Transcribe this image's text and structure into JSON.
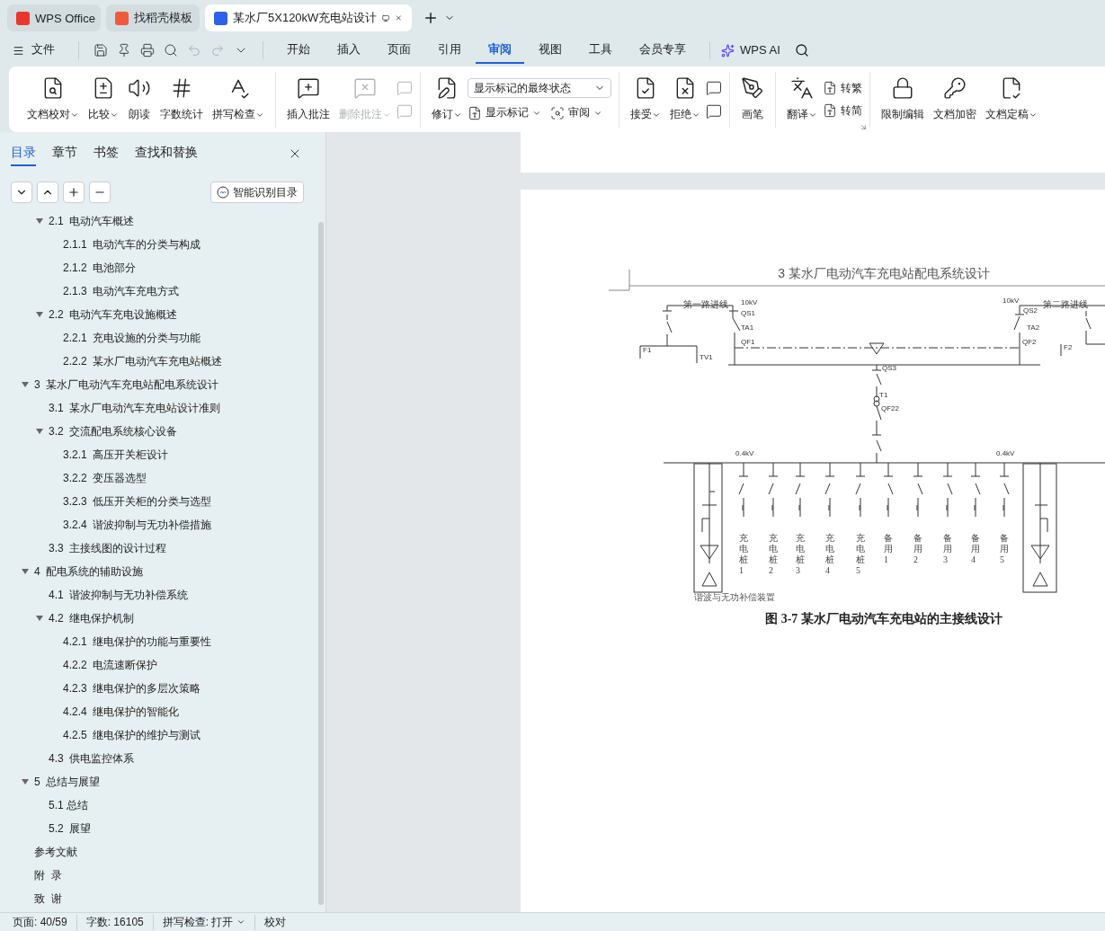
{
  "app_tabs": [
    {
      "label": "WPS Office",
      "selected": false
    },
    {
      "label": "找稻壳模板",
      "selected": false
    },
    {
      "label": "某水厂5X120kW充电站设计",
      "selected": true
    }
  ],
  "menu": {
    "file": "文件",
    "quick_access": [
      {
        "disabled": false
      },
      {
        "disabled": false
      },
      {
        "disabled": false
      },
      {
        "disabled": false
      },
      {
        "disabled": true
      },
      {
        "disabled": true
      },
      {
        "disabled": false
      }
    ],
    "tabs": [
      {
        "label": "开始",
        "selected": false
      },
      {
        "label": "插入",
        "selected": false
      },
      {
        "label": "页面",
        "selected": false
      },
      {
        "label": "引用",
        "selected": false
      },
      {
        "label": "审阅",
        "selected": true
      },
      {
        "label": "视图",
        "selected": false
      },
      {
        "label": "工具",
        "selected": false
      },
      {
        "label": "会员专享",
        "selected": false
      }
    ],
    "ai": "WPS AI"
  },
  "ribbon": [
    {
      "items": [
        {
          "kind": "large",
          "label": "文档校对",
          "dropdown": true,
          "disabled": false
        },
        {
          "kind": "large",
          "label": "比较",
          "dropdown": true,
          "disabled": false
        },
        {
          "kind": "large",
          "label": "朗读",
          "dropdown": false,
          "disabled": false
        },
        {
          "kind": "large",
          "label": "字数统计",
          "dropdown": false,
          "disabled": false
        },
        {
          "kind": "large",
          "label": "拼写检查",
          "dropdown": true,
          "disabled": false
        }
      ]
    },
    {
      "items": [
        {
          "kind": "large",
          "label": "插入批注",
          "dropdown": false,
          "disabled": false
        },
        {
          "kind": "large",
          "label": "删除批注",
          "dropdown": true,
          "disabled": true
        },
        {
          "kind": "stack",
          "items": [
            {
              "kind": "icon",
              "disabled": true
            },
            {
              "kind": "icon",
              "disabled": true
            }
          ]
        }
      ]
    },
    {
      "items": [
        {
          "kind": "large",
          "label": "修订",
          "dropdown": true,
          "disabled": false
        },
        {
          "kind": "stack",
          "items": [
            {
              "kind": "select",
              "value": "显示标记的最终状态"
            },
            {
              "kind": "row",
              "items": [
                {
                  "kind": "small",
                  "label": "显示标记",
                  "dropdown": true
                },
                {
                  "kind": "small",
                  "label": "审阅",
                  "dropdown": true
                }
              ]
            }
          ]
        }
      ]
    },
    {
      "items": [
        {
          "kind": "large",
          "label": "接受",
          "dropdown": true,
          "disabled": false
        },
        {
          "kind": "large",
          "label": "拒绝",
          "dropdown": true,
          "disabled": false
        },
        {
          "kind": "stack",
          "items": [
            {
              "kind": "icon",
              "disabled": false
            },
            {
              "kind": "icon",
              "disabled": false
            }
          ]
        }
      ]
    },
    {
      "items": [
        {
          "kind": "large",
          "label": "画笔",
          "dropdown": false,
          "disabled": false
        }
      ]
    },
    {
      "items": [
        {
          "kind": "large",
          "label": "翻译",
          "dropdown": true,
          "disabled": false
        },
        {
          "kind": "stack",
          "items": [
            {
              "kind": "small",
              "label": "转繁",
              "dropdown": false
            },
            {
              "kind": "small",
              "label": "转简",
              "dropdown": false
            }
          ]
        }
      ],
      "launcher": true
    },
    {
      "items": [
        {
          "kind": "large",
          "label": "限制编辑",
          "dropdown": false,
          "disabled": false
        },
        {
          "kind": "large",
          "label": "文档加密",
          "dropdown": false,
          "disabled": false
        },
        {
          "kind": "large",
          "label": "文档定稿",
          "dropdown": true,
          "disabled": false
        }
      ]
    }
  ],
  "nav_pane": {
    "tabs": [
      {
        "label": "目录",
        "selected": true
      },
      {
        "label": "章节",
        "selected": false
      },
      {
        "label": "书签",
        "selected": false
      },
      {
        "label": "查找和替换",
        "selected": false
      }
    ],
    "smart_button": "智能识别目录",
    "tree": [
      {
        "children": [
          {
            "label": "2.1  电动汽车概述",
            "expanded": true,
            "children": [
              {
                "label": "2.1.1  电动汽车的分类与构成"
              },
              {
                "label": "2.1.2  电池部分"
              },
              {
                "label": "2.1.3  电动汽车充电方式"
              }
            ]
          },
          {
            "label": "2.2  电动汽车充电设施概述",
            "expanded": true,
            "children": [
              {
                "label": "2.2.1  充电设施的分类与功能"
              },
              {
                "label": "2.2.2  某水厂电动汽车充电站概述"
              }
            ]
          }
        ]
      },
      {
        "label": "3  某水厂电动汽车充电站配电系统设计",
        "expanded": true,
        "children": [
          {
            "label": "3.1  某水厂电动汽车充电站设计准则"
          },
          {
            "label": "3.2  交流配电系统核心设备",
            "expanded": true,
            "children": [
              {
                "label": "3.2.1  高压开关柜设计"
              },
              {
                "label": "3.2.2  变压器选型"
              },
              {
                "label": "3.2.3  低压开关柜的分类与选型"
              },
              {
                "label": "3.2.4  谐波抑制与无功补偿措施"
              }
            ]
          },
          {
            "label": "3.3  主接线图的设计过程"
          }
        ]
      },
      {
        "label": "4  配电系统的辅助设施",
        "expanded": true,
        "children": [
          {
            "label": "4.1  谐波抑制与无功补偿系统"
          },
          {
            "label": "4.2  继电保护机制",
            "expanded": true,
            "children": [
              {
                "label": "4.2.1  继电保护的功能与重要性"
              },
              {
                "label": "4.2.2  电流速断保护"
              },
              {
                "label": "4.2.3  继电保护的多层次策略"
              },
              {
                "label": "4.2.4  继电保护的智能化"
              },
              {
                "label": "4.2.5  继电保护的维护与测试"
              }
            ]
          },
          {
            "label": "4.3  供电监控体系"
          }
        ]
      },
      {
        "label": "5  总结与展望",
        "expanded": true,
        "children": [
          {
            "label": "5.1 总结"
          },
          {
            "label": "5.2  展望"
          }
        ]
      },
      {
        "label": "参考文献"
      },
      {
        "label": "附  录"
      },
      {
        "label": "致  谢"
      }
    ]
  },
  "document": {
    "header": "3  某水厂电动汽车充电站配电系统设计",
    "diagram_labels": [
      "第一路进线",
      "10kV",
      "QS1",
      "TA1",
      "QF1",
      "F1",
      "TV1",
      "10kV",
      "QS2",
      "TA2",
      "QF2",
      "第二路进线",
      "F2",
      "QS3",
      "T1",
      "QF22",
      "0.4kV",
      "0.4kV"
    ],
    "feeders": [
      "充电桩1",
      "充电桩2",
      "充电桩3",
      "充电桩4",
      "充电桩5",
      "备用1",
      "备用2",
      "备用3",
      "备用4",
      "备用5"
    ],
    "compensator_label": "谐波与无功补偿装置",
    "caption": "图 3-7 某水厂电动汽车充电站的主接线设计"
  },
  "status_bar": {
    "page": "页面: 40/59",
    "words": "字数: 16105",
    "spell": "拼写检查: 打开",
    "proof": "校对"
  }
}
